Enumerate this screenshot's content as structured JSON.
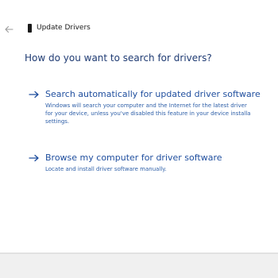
{
  "window": {
    "title": "Update Drivers"
  },
  "main": {
    "heading": "How do you want to search for drivers?",
    "options": [
      {
        "label": "Search automatically for updated driver software",
        "description": "Windows will search your computer and the Internet for the latest driver\nfor your device, unless you've disabled this feature in your device installa\nsettings."
      },
      {
        "label": "Browse my computer for driver software",
        "description": "Locate and install driver software manually."
      }
    ]
  },
  "icons": {
    "back": "back-arrow-icon",
    "device": "device-icon",
    "option_arrow": "right-arrow-icon"
  },
  "colors": {
    "heading": "#1f3b73",
    "link": "#1f4e9e",
    "description": "#2e5fa8",
    "footer_bg": "#f0f0f0"
  }
}
